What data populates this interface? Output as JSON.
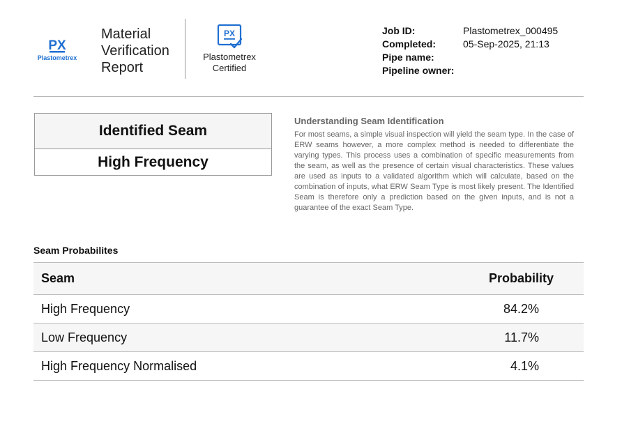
{
  "header": {
    "brand_name": "Plastometrex",
    "report_title": [
      "Material",
      "Verification",
      "Report"
    ],
    "certified": [
      "Plastometrex",
      "Certified"
    ],
    "brand_color": "#1f6fd1"
  },
  "job": {
    "rows": [
      {
        "label": "Job ID:",
        "value": "Plastometrex_000495"
      },
      {
        "label": "Completed:",
        "value": "05-Sep-2025, 21:13"
      },
      {
        "label": "Pipe name:",
        "value": ""
      },
      {
        "label": "Pipeline owner:",
        "value": ""
      }
    ]
  },
  "identified": {
    "heading": "Identified Seam",
    "value": "High Frequency"
  },
  "understanding": {
    "title": "Understanding Seam Identification",
    "body": "For most seams, a simple visual inspection will yield the seam type. In the case of ERW seams however, a more complex method is needed to differentiate the varying types. This process uses a combination of specific measurements from the seam, as well as the presence of certain visual characteristics. These values are used as inputs to a validated algorithm which will calculate, based on the combination of inputs, what ERW Seam Type is most likely present. The Identified Seam is therefore only a prediction based on the given inputs, and is not a guarantee of the exact Seam Type."
  },
  "probabilities": {
    "title": "Seam Probabilites",
    "columns": [
      "Seam",
      "Probability"
    ],
    "rows": [
      {
        "seam": "High Frequency",
        "probability": "84.2%"
      },
      {
        "seam": "Low Frequency",
        "probability": "11.7%"
      },
      {
        "seam": "High Frequency Normalised",
        "probability": "4.1%"
      }
    ]
  }
}
